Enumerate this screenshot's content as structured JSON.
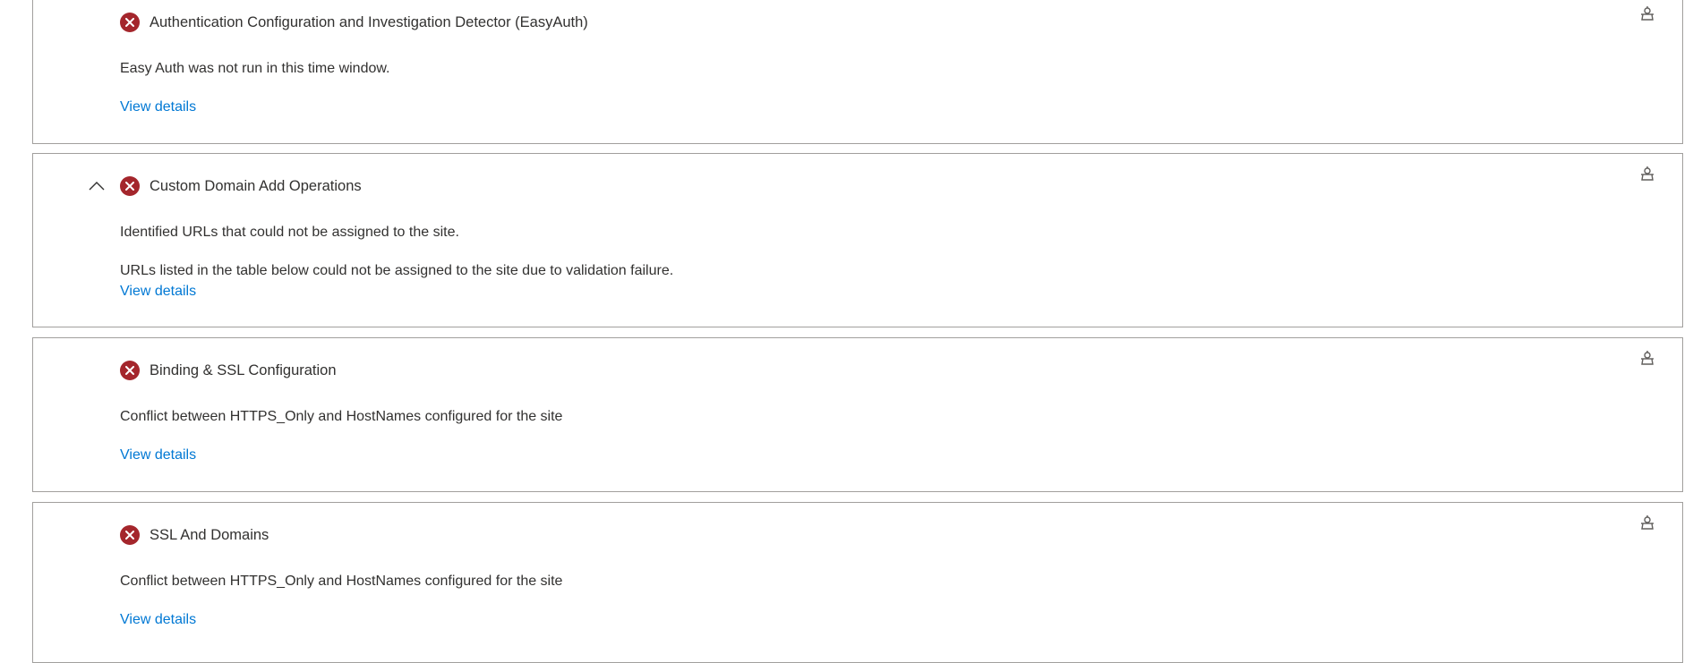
{
  "cards": [
    {
      "title": "Authentication Configuration and Investigation Detector (EasyAuth)",
      "lines": [
        "Easy Auth was not run in this time window."
      ],
      "link": "View details",
      "status_icon": "error-circle-icon",
      "action_icon": "diagnostic-bot-icon"
    },
    {
      "title": "Custom Domain Add Operations",
      "lines": [
        "Identified URLs that could not be assigned to the site.",
        "URLs listed in the table below could not be assigned to the site due to validation failure."
      ],
      "link": "View details",
      "expanded": true,
      "status_icon": "error-circle-icon",
      "action_icon": "diagnostic-bot-icon"
    },
    {
      "title": "Binding & SSL Configuration",
      "lines": [
        "Conflict between HTTPS_Only and HostNames configured for the site"
      ],
      "link": "View details",
      "status_icon": "error-circle-icon",
      "action_icon": "diagnostic-bot-icon"
    },
    {
      "title": "SSL And Domains",
      "lines": [
        "Conflict between HTTPS_Only and HostNames configured for the site"
      ],
      "link": "View details",
      "status_icon": "error-circle-icon",
      "action_icon": "diagnostic-bot-icon"
    }
  ],
  "colors": {
    "error": "#a4262c",
    "link": "#0078d4",
    "border": "#a19f9d",
    "text": "#323130"
  }
}
